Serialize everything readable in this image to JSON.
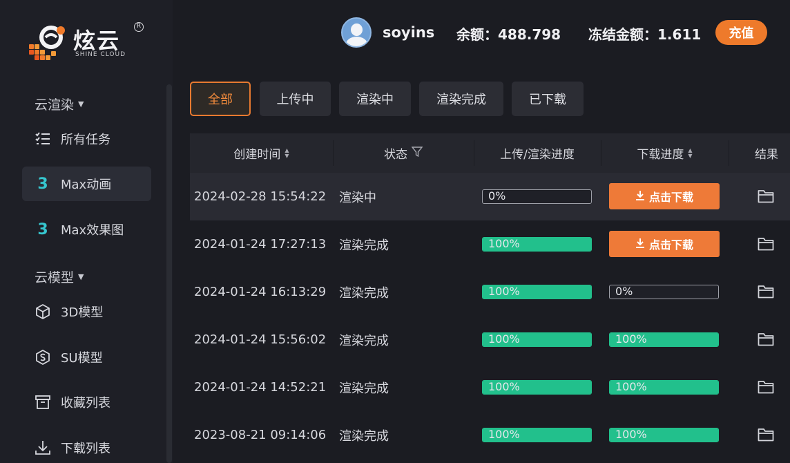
{
  "brand": {
    "name": "炫云",
    "sub": "SHINE CLOUD",
    "reg": "R"
  },
  "sidebar": {
    "groups": [
      {
        "label": "云渲染"
      },
      {
        "label": "云模型"
      }
    ],
    "items": [
      {
        "label": "所有任务",
        "icon": "list-icon"
      },
      {
        "label": "Max动画",
        "icon": "3dsmax-icon",
        "glyph": "3"
      },
      {
        "label": "Max效果图",
        "icon": "3dsmax-icon",
        "glyph": "3"
      },
      {
        "label": "3D模型",
        "icon": "cube-icon"
      },
      {
        "label": "SU模型",
        "icon": "su-icon"
      },
      {
        "label": "收藏列表",
        "icon": "archive-icon"
      },
      {
        "label": "下载列表",
        "icon": "download-icon"
      }
    ]
  },
  "header": {
    "username": "soyins",
    "balance": "余额：488.798",
    "frozen": "冻结金额：1.611",
    "recharge_label": "充值"
  },
  "tabs": [
    {
      "label": "全部",
      "active": true
    },
    {
      "label": "上传中",
      "active": false
    },
    {
      "label": "渲染中",
      "active": false
    },
    {
      "label": "渲染完成",
      "active": false
    },
    {
      "label": "已下载",
      "active": false
    }
  ],
  "table": {
    "columns": [
      "创建时间",
      "状态",
      "上传/渲染进度",
      "下载进度",
      "结果"
    ],
    "download_label": "点击下载",
    "rows": [
      {
        "time": "2024-02-28 15:54:22",
        "status": "渲染中",
        "render_progress": "0%",
        "render_value": 0,
        "download": "button",
        "download_progress": "",
        "download_value": 0
      },
      {
        "time": "2024-01-24 17:27:13",
        "status": "渲染完成",
        "render_progress": "100%",
        "render_value": 100,
        "download": "button",
        "download_progress": "",
        "download_value": 0
      },
      {
        "time": "2024-01-24 16:13:29",
        "status": "渲染完成",
        "render_progress": "100%",
        "render_value": 100,
        "download": "progress",
        "download_progress": "0%",
        "download_value": 0
      },
      {
        "time": "2024-01-24 15:56:02",
        "status": "渲染完成",
        "render_progress": "100%",
        "render_value": 100,
        "download": "progress",
        "download_progress": "100%",
        "download_value": 100
      },
      {
        "time": "2024-01-24 14:52:21",
        "status": "渲染完成",
        "render_progress": "100%",
        "render_value": 100,
        "download": "progress",
        "download_progress": "100%",
        "download_value": 100
      },
      {
        "time": "2023-08-21 09:14:06",
        "status": "渲染完成",
        "render_progress": "100%",
        "render_value": 100,
        "download": "progress",
        "download_progress": "100%",
        "download_value": 100
      }
    ]
  },
  "colors": {
    "accent": "#ee7a38",
    "progress": "#22c08c",
    "bg": "#1b1c22"
  }
}
